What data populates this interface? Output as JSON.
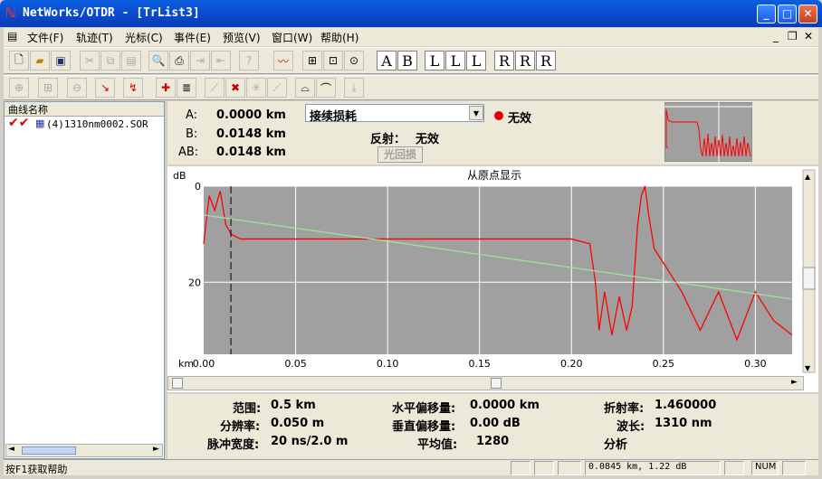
{
  "window": {
    "title": "NetWorks/OTDR - [TrList3]"
  },
  "menu": [
    "文件(F)",
    "轨迹(T)",
    "光标(C)",
    "事件(E)",
    "预览(V)",
    "窗口(W)",
    "帮助(H)"
  ],
  "letter_buttons": [
    "A",
    "B",
    "L",
    "L",
    "L",
    "R",
    "R",
    "R"
  ],
  "left_panel": {
    "header": "曲线名称",
    "trace_item": "(4)1310nm0002.SOR"
  },
  "cursor": {
    "a_label": "A:",
    "a_value": "0.0000 km",
    "b_label": "B:",
    "b_value": "0.0148 km",
    "ab_label": "AB:",
    "ab_value": "0.0148 km"
  },
  "dropdown": {
    "selected": "接续损耗"
  },
  "status": {
    "indicator_text": "无效",
    "reflect_label": "反射：",
    "reflect_value": "无效",
    "return_loss_button": "光回损"
  },
  "chart_data": {
    "type": "line",
    "title": "从原点显示",
    "ylabel": "dB",
    "xlabel": "km",
    "xlim": [
      0.0,
      0.32
    ],
    "ylim": [
      0,
      35
    ],
    "x_ticks": [
      "0.00",
      "0.05",
      "0.10",
      "0.15",
      "0.20",
      "0.25",
      "0.30"
    ],
    "y_ticks": [
      "0",
      "20"
    ],
    "series": [
      {
        "color": "#ff0000",
        "x": [
          0.0,
          0.003,
          0.006,
          0.009,
          0.012,
          0.015,
          0.02,
          0.05,
          0.1,
          0.15,
          0.2,
          0.21,
          0.213,
          0.215,
          0.218,
          0.222,
          0.226,
          0.23,
          0.233,
          0.236,
          0.238,
          0.24,
          0.242,
          0.245,
          0.25,
          0.26,
          0.27,
          0.28,
          0.29,
          0.3,
          0.31,
          0.32
        ],
        "y": [
          12,
          2,
          5,
          1,
          8,
          10,
          11,
          11,
          11,
          11,
          11,
          12,
          20,
          30,
          22,
          31,
          23,
          30,
          25,
          8,
          2,
          0,
          6,
          13,
          16,
          22,
          30,
          22,
          32,
          22,
          28,
          31
        ]
      },
      {
        "color": "#a0e0a0",
        "x": [
          0.0,
          0.32
        ],
        "y": [
          6,
          23.5
        ]
      }
    ],
    "cursor_x": 0.0148,
    "grid": true
  },
  "params": {
    "range_label": "范围:",
    "range_value": "0.5 km",
    "resolution_label": "分辨率:",
    "resolution_value": "0.050 m",
    "pulse_label": "脉冲宽度:",
    "pulse_value": "20 ns/2.0 m",
    "hoffset_label": "水平偏移量:",
    "hoffset_value": "0.0000 km",
    "voffset_label": "垂直偏移量:",
    "voffset_value": "0.00 dB",
    "avg_label": "平均值:",
    "avg_value": "1280",
    "ior_label": "折射率:",
    "ior_value": "1.460000",
    "wl_label": "波长:",
    "wl_value": "1310 nm",
    "analysis_label": "分析"
  },
  "statusbar": {
    "help": "按F1获取帮助",
    "position": "0.0845 km, 1.22 dB",
    "num": "NUM"
  },
  "colors": {
    "titlebar": "#0b4fd0",
    "trace": "#ff0000",
    "lsa_line": "#a0e0a0",
    "plot_bg": "#a0a0a0"
  }
}
